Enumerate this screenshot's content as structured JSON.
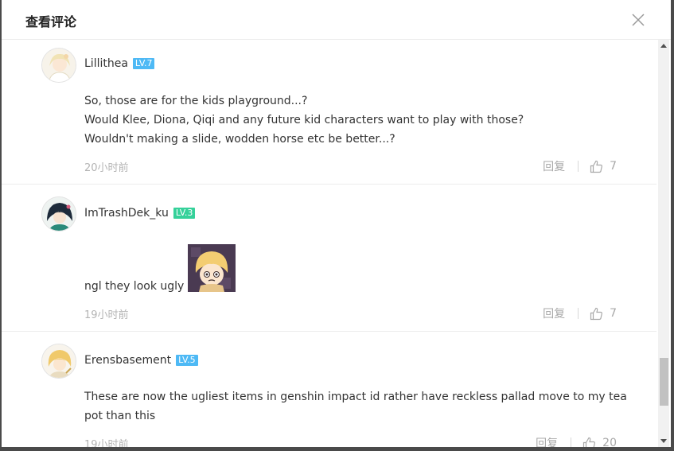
{
  "modal": {
    "title": "查看评论"
  },
  "comments": [
    {
      "user": "Lillithea",
      "level": "LV.7",
      "level_color": "#4eb9f5",
      "lines": [
        "So, those are for the kids playground...?",
        "Would Klee, Diona, Qiqi and any future kid characters want to play with those?",
        "Wouldn't making a slide, wodden horse etc be better...?"
      ],
      "time": "20小时前",
      "reply_label": "回复",
      "likes": "7"
    },
    {
      "user": "ImTrashDek_ku",
      "level": "LV.3",
      "level_color": "#35d19a",
      "lines": [
        "ngl they look ugly"
      ],
      "time": "19小时前",
      "reply_label": "回复",
      "likes": "7"
    },
    {
      "user": "Erensbasement",
      "level": "LV.5",
      "level_color": "#4eb9f5",
      "lines": [
        "These are now the ugliest items in genshin impact id rather have reckless pallad move to my tea",
        "pot than this"
      ],
      "time": "19小时前",
      "reply_label": "回复",
      "likes": "20"
    }
  ],
  "icons": {
    "close": "close-icon",
    "like": "thumbs-up-icon",
    "scroll_up": "triangle-up-icon",
    "scroll_down": "triangle-down-icon"
  }
}
